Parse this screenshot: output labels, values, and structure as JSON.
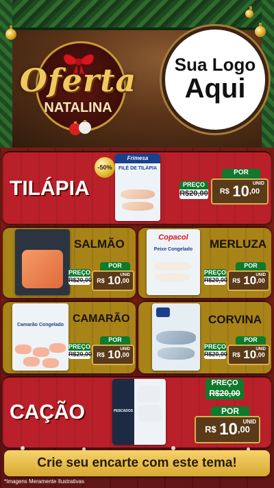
{
  "header": {
    "seal_title": "Oferta",
    "seal_subtitle": "NATALINA",
    "logo_line1": "Sua Logo",
    "logo_line2": "Aqui"
  },
  "products": [
    {
      "name": "TILÁPIA",
      "brand": "Frimesa",
      "pack_label": "FILÉ DE TILÁPIA",
      "discount": "-50%",
      "preco_label": "PREÇO",
      "old_price": "R$20,00",
      "por_label": "POR",
      "currency": "R$",
      "price_int": "10",
      "price_cents": ",00",
      "unit": "UNID"
    },
    {
      "name": "SALMÃO",
      "brand": "",
      "pack_label": "",
      "preco_label": "PREÇO",
      "old_price": "R$20,00",
      "por_label": "POR",
      "currency": "R$",
      "price_int": "10",
      "price_cents": ",00",
      "unit": "UNID"
    },
    {
      "name": "MERLUZA",
      "brand": "Copacol",
      "pack_label": "Peixe Congelado",
      "preco_label": "PREÇO",
      "old_price": "R$20,00",
      "por_label": "POR",
      "currency": "R$",
      "price_int": "10",
      "price_cents": ",00",
      "unit": "UNID"
    },
    {
      "name": "CAMARÃO",
      "brand": "",
      "pack_label": "Camarão Congelado",
      "preco_label": "PREÇO",
      "old_price": "R$20,00",
      "por_label": "POR",
      "currency": "R$",
      "price_int": "10",
      "price_cents": ",00",
      "unit": "UNID"
    },
    {
      "name": "CORVINA",
      "brand": "",
      "pack_label": "",
      "preco_label": "PREÇO",
      "old_price": "R$20,00",
      "por_label": "POR",
      "currency": "R$",
      "price_int": "10",
      "price_cents": ",00",
      "unit": "UNID"
    },
    {
      "name": "CAÇÃO",
      "brand": "",
      "pack_label": "PESCADOS",
      "preco_label": "PREÇO",
      "old_price": "R$20,00",
      "por_label": "POR",
      "currency": "R$",
      "price_int": "10",
      "price_cents": ",00",
      "unit": "UNID"
    }
  ],
  "cta": "Crie seu encarte com este tema!",
  "disclaimer": "*Imagens Meramente Ilustrativas",
  "colors": {
    "red_card": "#b9202a",
    "gold_card": "#a88318",
    "green_label": "#0f7a2c",
    "price_box": "#5a3a18"
  }
}
